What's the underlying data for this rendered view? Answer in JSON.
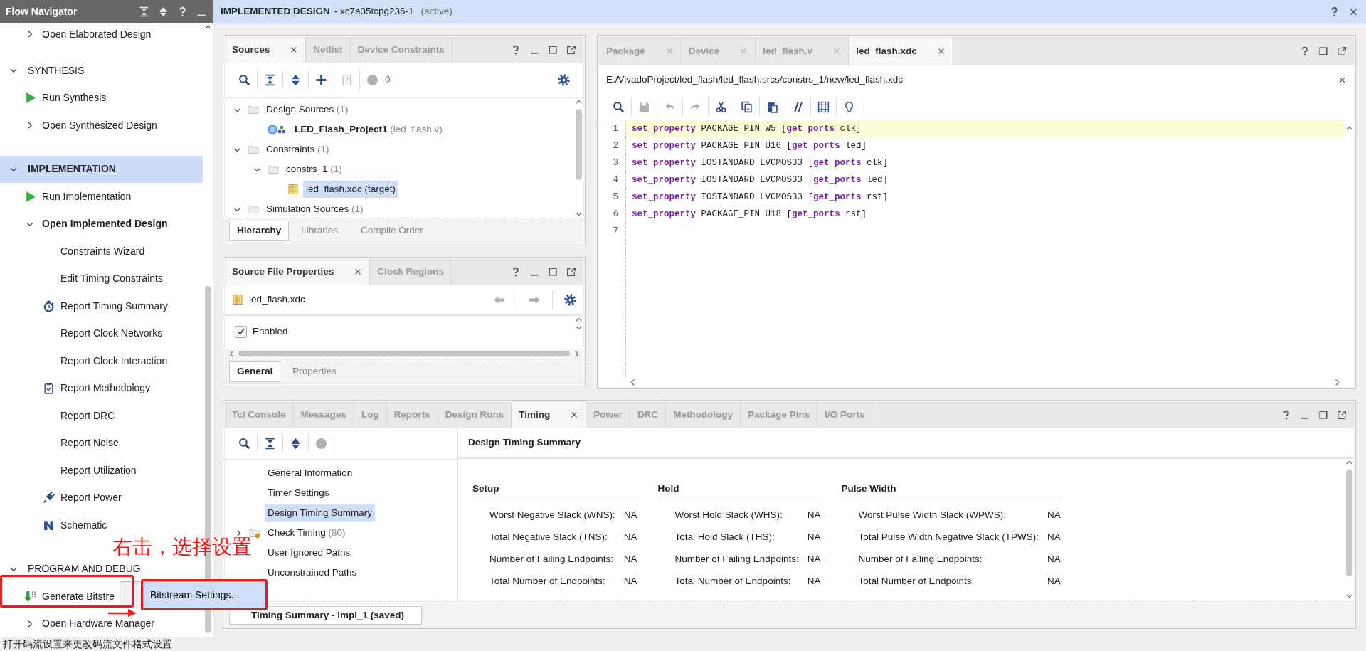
{
  "flow_navigator": {
    "title": "Flow Navigator",
    "partial_item": {
      "label": "Open Elaborated Design",
      "expanded": false
    },
    "sections": [
      {
        "label": "SYNTHESIS",
        "expanded": true,
        "selected": false,
        "items": [
          {
            "label": "Run Synthesis",
            "kind": "run"
          },
          {
            "label": "Open Synthesized Design",
            "expanded": false
          }
        ]
      },
      {
        "label": "IMPLEMENTATION",
        "expanded": true,
        "selected": true,
        "items": [
          {
            "label": "Run Implementation",
            "kind": "run"
          },
          {
            "label": "Open Implemented Design",
            "expanded": true,
            "children": [
              {
                "label": "Constraints Wizard"
              },
              {
                "label": "Edit Timing Constraints"
              },
              {
                "label": "Report Timing Summary",
                "kind": "stopwatch"
              },
              {
                "label": "Report Clock Networks"
              },
              {
                "label": "Report Clock Interaction"
              },
              {
                "label": "Report Methodology",
                "kind": "clipboard"
              },
              {
                "label": "Report DRC"
              },
              {
                "label": "Report Noise"
              },
              {
                "label": "Report Utilization"
              },
              {
                "label": "Report Power",
                "kind": "plug"
              },
              {
                "label": "Schematic",
                "kind": "schematic"
              }
            ]
          }
        ]
      },
      {
        "label": "PROGRAM AND DEBUG",
        "expanded": true,
        "selected": false,
        "items": [
          {
            "label": "Generate Bitstre",
            "kind": "bitstream"
          },
          {
            "label": "Open Hardware Manager",
            "expanded": false
          }
        ]
      }
    ]
  },
  "design_header": {
    "title": "IMPLEMENTED DESIGN",
    "part": "- xc7a35tcpg236-1",
    "status": "(active)"
  },
  "sources_panel": {
    "tabs": [
      {
        "label": "Sources",
        "selected": true
      },
      {
        "label": "Netlist",
        "selected": false
      },
      {
        "label": "Device Constraints",
        "selected": false
      }
    ],
    "warning_count": "0",
    "tree": [
      {
        "label": "Design Sources",
        "count": "(1)",
        "kind": "folder",
        "expanded": true,
        "selected": false,
        "children": [
          {
            "label": "LED_Flash_Project1",
            "detail": "(led_flash.v)",
            "kind": "top-module",
            "selected": false
          }
        ]
      },
      {
        "label": "Constraints",
        "count": "(1)",
        "kind": "folder",
        "expanded": true,
        "selected": false,
        "children": [
          {
            "label": "constrs_1",
            "count": "(1)",
            "kind": "folder",
            "expanded": true,
            "selected": false,
            "children": [
              {
                "label": "led_flash.xdc (target)",
                "kind": "constraints-file",
                "selected": true
              }
            ]
          }
        ]
      },
      {
        "label": "Simulation Sources",
        "count": "(1)",
        "kind": "folder",
        "expanded": true,
        "selected": false
      }
    ],
    "view_tabs": [
      {
        "label": "Hierarchy",
        "selected": true
      },
      {
        "label": "Libraries",
        "selected": false
      },
      {
        "label": "Compile Order",
        "selected": false
      }
    ]
  },
  "properties_panel": {
    "tabs": [
      {
        "label": "Source File Properties",
        "selected": true
      },
      {
        "label": "Clock Regions",
        "selected": false
      }
    ],
    "file": "led_flash.xdc",
    "options": [
      {
        "label": "Enabled",
        "checked": true
      }
    ],
    "view_tabs": [
      {
        "label": "General",
        "selected": true
      },
      {
        "label": "Properties",
        "selected": false
      }
    ]
  },
  "editor": {
    "tabs": [
      {
        "label": "Package",
        "selected": false
      },
      {
        "label": "Device",
        "selected": false
      },
      {
        "label": "led_flash.v",
        "selected": false
      },
      {
        "label": "led_flash.xdc",
        "selected": true
      }
    ],
    "path": "E:/VivadoProject/led_flash/led_flash.srcs/constrs_1/new/led_flash.xdc",
    "lines": [
      {
        "number": "1",
        "current": true,
        "tokens": [
          {
            "kind": "keyword",
            "text": "set_property"
          },
          {
            "kind": "plain",
            "text": " PACKAGE_PIN W5 ["
          },
          {
            "kind": "keyword",
            "text": "get_ports"
          },
          {
            "kind": "plain",
            "text": " clk]"
          }
        ]
      },
      {
        "number": "2",
        "current": false,
        "tokens": [
          {
            "kind": "keyword",
            "text": "set_property"
          },
          {
            "kind": "plain",
            "text": " PACKAGE_PIN U16 ["
          },
          {
            "kind": "keyword",
            "text": "get_ports"
          },
          {
            "kind": "plain",
            "text": " led]"
          }
        ]
      },
      {
        "number": "3",
        "current": false,
        "tokens": [
          {
            "kind": "keyword",
            "text": "set_property"
          },
          {
            "kind": "plain",
            "text": " IOSTANDARD LVCMOS33 ["
          },
          {
            "kind": "keyword",
            "text": "get_ports"
          },
          {
            "kind": "plain",
            "text": " clk]"
          }
        ]
      },
      {
        "number": "4",
        "current": false,
        "tokens": [
          {
            "kind": "keyword",
            "text": "set_property"
          },
          {
            "kind": "plain",
            "text": " IOSTANDARD LVCMOS33 ["
          },
          {
            "kind": "keyword",
            "text": "get_ports"
          },
          {
            "kind": "plain",
            "text": " led]"
          }
        ]
      },
      {
        "number": "5",
        "current": false,
        "tokens": [
          {
            "kind": "keyword",
            "text": "set_property"
          },
          {
            "kind": "plain",
            "text": " IOSTANDARD LVCMOS33 ["
          },
          {
            "kind": "keyword",
            "text": "get_ports"
          },
          {
            "kind": "plain",
            "text": " rst]"
          }
        ]
      },
      {
        "number": "6",
        "current": false,
        "tokens": [
          {
            "kind": "keyword",
            "text": "set_property"
          },
          {
            "kind": "plain",
            "text": " PACKAGE_PIN U18 ["
          },
          {
            "kind": "keyword",
            "text": "get_ports"
          },
          {
            "kind": "plain",
            "text": " rst]"
          }
        ]
      },
      {
        "number": "7",
        "current": false
      }
    ]
  },
  "bottom_panel": {
    "tabs": [
      {
        "label": "Tcl Console",
        "selected": false
      },
      {
        "label": "Messages",
        "selected": false
      },
      {
        "label": "Log",
        "selected": false
      },
      {
        "label": "Reports",
        "selected": false
      },
      {
        "label": "Design Runs",
        "selected": false
      },
      {
        "label": "Timing",
        "selected": true
      },
      {
        "label": "Power",
        "selected": false
      },
      {
        "label": "DRC",
        "selected": false
      },
      {
        "label": "Methodology",
        "selected": false
      },
      {
        "label": "Package Pins",
        "selected": false
      },
      {
        "label": "I/O Ports",
        "selected": false
      }
    ],
    "tree": [
      {
        "label": "General Information",
        "selected": false
      },
      {
        "label": "Timer Settings",
        "selected": false
      },
      {
        "label": "Design Timing Summary",
        "selected": true
      },
      {
        "label": "Check Timing",
        "count": "(80)",
        "kind": "warning-folder",
        "expanded": false,
        "selected": false
      },
      {
        "label": "User Ignored Paths",
        "selected": false
      },
      {
        "label": "Unconstrained Paths",
        "selected": false
      }
    ],
    "report_title": "Design Timing Summary",
    "groups": [
      {
        "title": "Setup",
        "rows": [
          {
            "label": "Worst Negative Slack (WNS):",
            "value": "NA"
          },
          {
            "label": "Total Negative Slack (TNS):",
            "value": "NA"
          },
          {
            "label": "Number of Failing Endpoints:",
            "value": "NA"
          },
          {
            "label": "Total Number of Endpoints:",
            "value": "NA"
          }
        ]
      },
      {
        "title": "Hold",
        "rows": [
          {
            "label": "Worst Hold Slack (WHS):",
            "value": "NA"
          },
          {
            "label": "Total Hold Slack (THS):",
            "value": "NA"
          },
          {
            "label": "Number of Failing Endpoints:",
            "value": "NA"
          },
          {
            "label": "Total Number of Endpoints:",
            "value": "NA"
          }
        ]
      },
      {
        "title": "Pulse Width",
        "rows": [
          {
            "label": "Worst Pulse Width Slack (WPWS):",
            "value": "NA"
          },
          {
            "label": "Total Pulse Width Negative Slack (TPWS):",
            "value": "NA"
          },
          {
            "label": "Number of Failing Endpoints:",
            "value": "NA"
          },
          {
            "label": "Total Number of Endpoints:",
            "value": "NA"
          }
        ]
      }
    ],
    "result_tabs": [
      {
        "label": "Timing Summary - impl_1 (saved)",
        "selected": true
      }
    ]
  },
  "context_menu": {
    "items": [
      {
        "label": "Bitstream Settings...",
        "selected": true
      }
    ]
  },
  "annotation": {
    "text": "右击，选择设置"
  },
  "status_bar": {
    "text": "打开码流设置来更改码流文件格式设置"
  }
}
